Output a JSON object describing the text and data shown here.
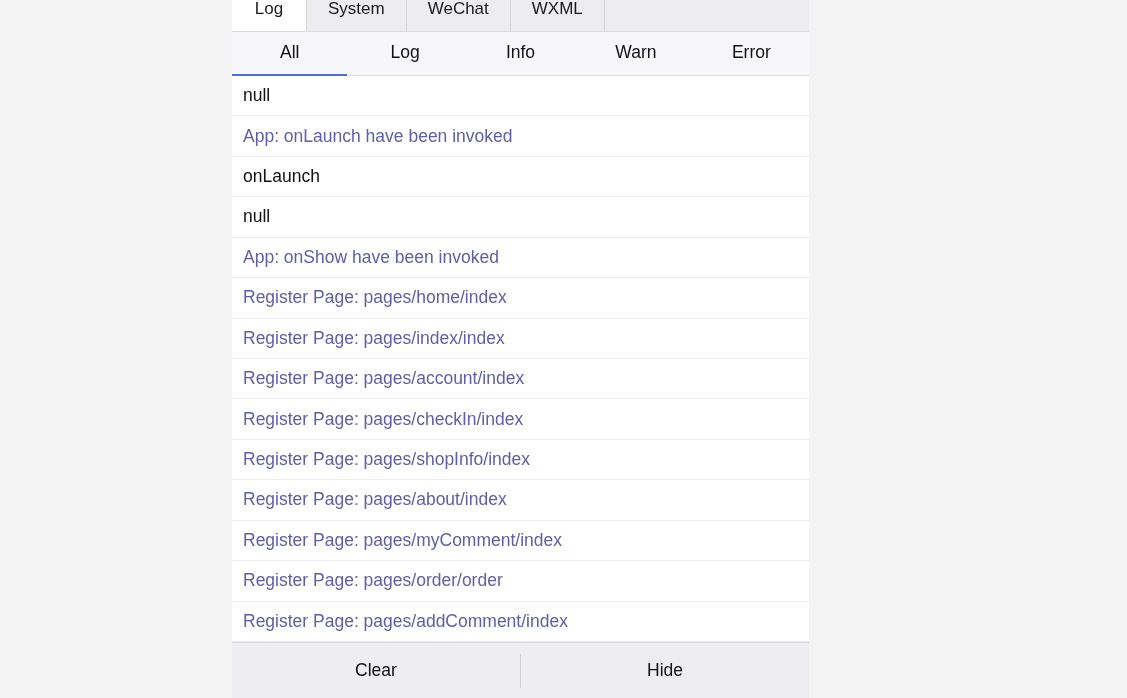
{
  "tabs": [
    {
      "label": "Log",
      "selected": true
    },
    {
      "label": "System",
      "selected": false
    },
    {
      "label": "WeChat",
      "selected": false
    },
    {
      "label": "WXML",
      "selected": false
    }
  ],
  "filters": [
    {
      "label": "All",
      "selected": true
    },
    {
      "label": "Log",
      "selected": false
    },
    {
      "label": "Info",
      "selected": false
    },
    {
      "label": "Warn",
      "selected": false
    },
    {
      "label": "Error",
      "selected": false
    }
  ],
  "entries": [
    {
      "kind": "log",
      "text": "null"
    },
    {
      "kind": "system",
      "text": "App: onLaunch have been invoked"
    },
    {
      "kind": "log",
      "text": "onLaunch"
    },
    {
      "kind": "log",
      "text": "null"
    },
    {
      "kind": "system",
      "text": "App: onShow have been invoked"
    },
    {
      "kind": "system",
      "text": "Register Page: pages/home/index"
    },
    {
      "kind": "system",
      "text": "Register Page: pages/index/index"
    },
    {
      "kind": "system",
      "text": "Register Page: pages/account/index"
    },
    {
      "kind": "system",
      "text": "Register Page: pages/checkIn/index"
    },
    {
      "kind": "system",
      "text": "Register Page: pages/shopInfo/index"
    },
    {
      "kind": "system",
      "text": "Register Page: pages/about/index"
    },
    {
      "kind": "system",
      "text": "Register Page: pages/myComment/index"
    },
    {
      "kind": "system",
      "text": "Register Page: pages/order/order"
    },
    {
      "kind": "system",
      "text": "Register Page: pages/addComment/index"
    }
  ],
  "buttons": [
    "Clear",
    "Hide"
  ]
}
